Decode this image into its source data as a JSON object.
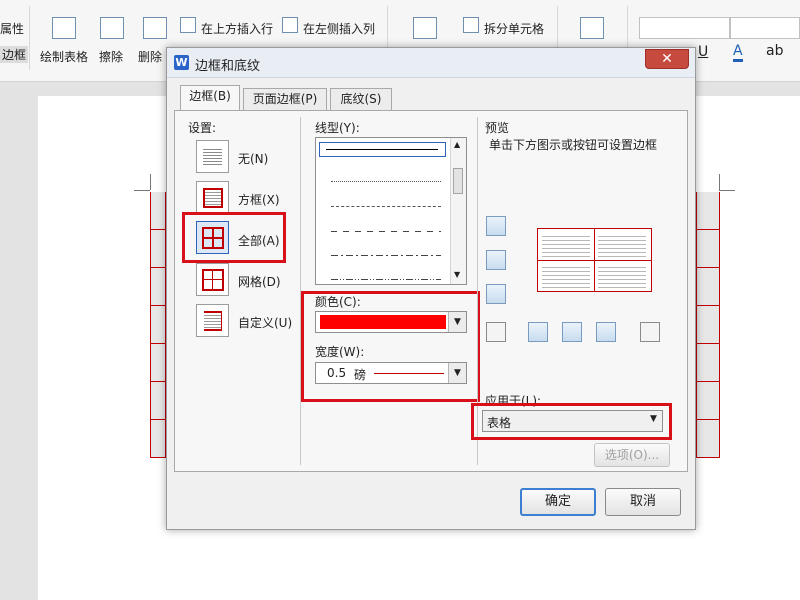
{
  "ribbon": {
    "properties": "属性",
    "border": "边框",
    "draw_table": "绘制表格",
    "erase": "擦除",
    "delete": "删除",
    "insert_above": "在上方插入行",
    "insert_left": "在左侧插入列",
    "split_cells": "拆分单元格",
    "font_underline": "U",
    "font_color": "A",
    "font_case": "ab"
  },
  "dialog": {
    "title": "边框和底纹",
    "tabs": [
      "边框(B)",
      "页面边框(P)",
      "底纹(S)"
    ],
    "settings_label": "设置:",
    "settings": [
      "无(N)",
      "方框(X)",
      "全部(A)",
      "网格(D)",
      "自定义(U)"
    ],
    "line_style_label": "线型(Y):",
    "color_label": "颜色(C):",
    "color_value": "#ff0000",
    "width_label": "宽度(W):",
    "width_value": "0.5",
    "width_unit": "磅",
    "preview_label": "预览",
    "preview_hint": "单击下方图示或按钮可设置边框",
    "apply_label": "应用于(L):",
    "apply_value": "表格",
    "options_button": "选项(O)...",
    "ok_button": "确定",
    "cancel_button": "取消"
  },
  "colors": {
    "highlight": "#d7101a",
    "table_border": "#c00000"
  }
}
